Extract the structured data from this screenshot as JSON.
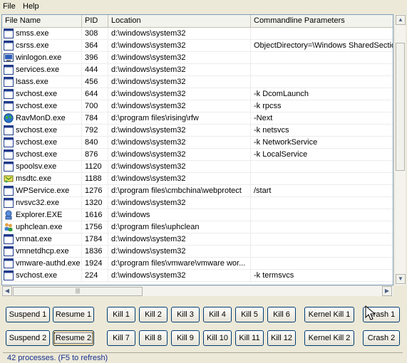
{
  "menu": [
    {
      "label": "File",
      "accel": "F"
    },
    {
      "label": "Help",
      "accel": "H"
    }
  ],
  "columns": [
    "File Name",
    "PID",
    "Location",
    "Commandline Parameters"
  ],
  "rows": [
    {
      "name": "smss.exe",
      "pid": "308",
      "location": "d:\\windows\\system32",
      "cmd": "",
      "icon": "app-window-icon"
    },
    {
      "name": "csrss.exe",
      "pid": "364",
      "location": "d:\\windows\\system32",
      "cmd": "ObjectDirectory=\\Windows SharedSection",
      "icon": "app-window-icon"
    },
    {
      "name": "winlogon.exe",
      "pid": "396",
      "location": "d:\\windows\\system32",
      "cmd": "",
      "icon": "winlogon-icon"
    },
    {
      "name": "services.exe",
      "pid": "444",
      "location": "d:\\windows\\system32",
      "cmd": "",
      "icon": "app-window-icon"
    },
    {
      "name": "lsass.exe",
      "pid": "456",
      "location": "d:\\windows\\system32",
      "cmd": "",
      "icon": "app-window-icon"
    },
    {
      "name": "svchost.exe",
      "pid": "644",
      "location": "d:\\windows\\system32",
      "cmd": "-k DcomLaunch",
      "icon": "app-window-icon"
    },
    {
      "name": "svchost.exe",
      "pid": "700",
      "location": "d:\\windows\\system32",
      "cmd": "-k rpcss",
      "icon": "app-window-icon"
    },
    {
      "name": "RavMonD.exe",
      "pid": "784",
      "location": "d:\\program files\\rising\\rfw",
      "cmd": "-Next",
      "icon": "globe-icon"
    },
    {
      "name": "svchost.exe",
      "pid": "792",
      "location": "d:\\windows\\system32",
      "cmd": "-k netsvcs",
      "icon": "app-window-icon"
    },
    {
      "name": "svchost.exe",
      "pid": "840",
      "location": "d:\\windows\\system32",
      "cmd": "-k NetworkService",
      "icon": "app-window-icon"
    },
    {
      "name": "svchost.exe",
      "pid": "876",
      "location": "d:\\windows\\system32",
      "cmd": "-k LocalService",
      "icon": "app-window-icon"
    },
    {
      "name": "spoolsv.exe",
      "pid": "1120",
      "location": "d:\\windows\\system32",
      "cmd": "",
      "icon": "app-window-icon"
    },
    {
      "name": "msdtc.exe",
      "pid": "1188",
      "location": "d:\\windows\\system32",
      "cmd": "",
      "icon": "msdtc-icon"
    },
    {
      "name": "WPService.exe",
      "pid": "1276",
      "location": "d:\\program files\\cmbchina\\webprotect",
      "cmd": "/start",
      "icon": "app-window-icon"
    },
    {
      "name": "nvsvc32.exe",
      "pid": "1320",
      "location": "d:\\windows\\system32",
      "cmd": "",
      "icon": "app-window-icon"
    },
    {
      "name": "Explorer.EXE",
      "pid": "1616",
      "location": "d:\\windows",
      "cmd": "",
      "icon": "explorer-icon"
    },
    {
      "name": "uphclean.exe",
      "pid": "1756",
      "location": "d:\\program files\\uphclean",
      "cmd": "",
      "icon": "users-icon"
    },
    {
      "name": "vmnat.exe",
      "pid": "1784",
      "location": "d:\\windows\\system32",
      "cmd": "",
      "icon": "app-window-icon"
    },
    {
      "name": "vmnetdhcp.exe",
      "pid": "1836",
      "location": "d:\\windows\\system32",
      "cmd": "",
      "icon": "app-window-icon"
    },
    {
      "name": "vmware-authd.exe",
      "pid": "1924",
      "location": "d:\\program files\\vmware\\vmware wor...",
      "cmd": "",
      "icon": "app-window-icon"
    },
    {
      "name": "svchost.exe",
      "pid": "224",
      "location": "d:\\windows\\system32",
      "cmd": "-k termsvcs",
      "icon": "app-window-icon"
    }
  ],
  "buttons": {
    "suspend1": "Suspend 1",
    "resume1": "Resume 1",
    "suspend2": "Suspend 2",
    "resume2": "Resume 2",
    "kill1": "Kill 1",
    "kill2": "Kill 2",
    "kill3": "Kill 3",
    "kill4": "Kill 4",
    "kill5": "Kill 5",
    "kill6": "Kill 6",
    "kill7": "Kill 7",
    "kill8": "Kill 8",
    "kill9": "Kill 9",
    "kill10": "Kill 10",
    "kill11": "Kill 11",
    "kill12": "Kill 12",
    "kernel_kill1": "Kernel Kill 1",
    "kernel_kill2": "Kernel Kill 2",
    "crash1": "Crash 1",
    "crash2": "Crash 2"
  },
  "status": "42 processes.  (F5 to refresh)",
  "colors": {
    "accent": "#16308e",
    "window_bg": "#ece9d8",
    "button_border": "#003c74"
  }
}
